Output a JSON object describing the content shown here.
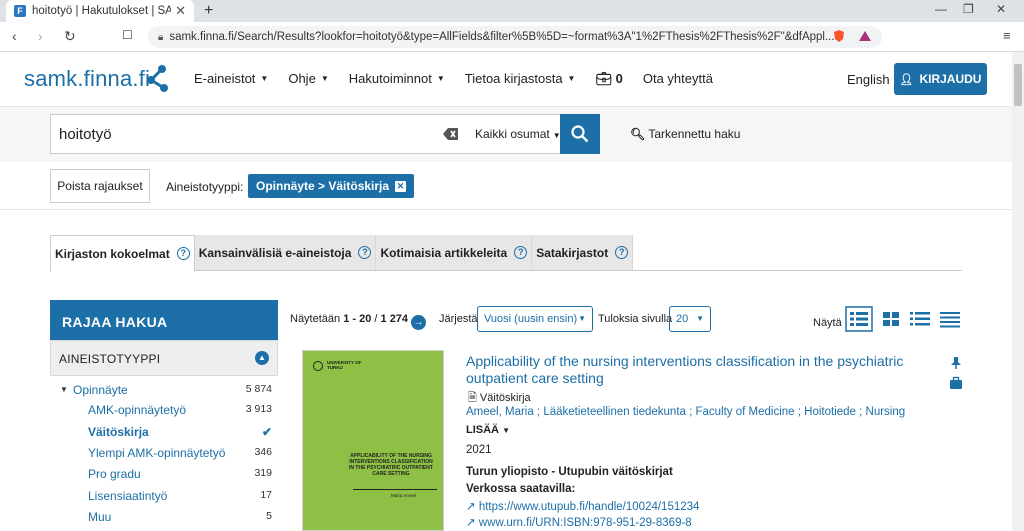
{
  "browser": {
    "tab_title": "hoitotyö | Hakutulokset | SAMK F",
    "favicon_letter": "F",
    "url": "samk.finna.fi/Search/Results?lookfor=hoitotyö&type=AllFields&filter%5B%5D=~format%3A\"1%2FThesis%2FThesis%2F\"&dfAppl..."
  },
  "header": {
    "logo": "samk.finna.fi",
    "nav": [
      "E-aineistot",
      "Ohje",
      "Hakutoiminnot",
      "Tietoa kirjastosta"
    ],
    "bag_count": "0",
    "contact": "Ota yhteyttä",
    "language": "English",
    "login": "KIRJAUDU"
  },
  "search": {
    "term": "hoitotyö",
    "scope": "Kaikki osumat",
    "advanced": "Tarkennettu haku"
  },
  "filters": {
    "remove_all": "Poista rajaukset",
    "label": "Aineistotyyppi:",
    "active": "Opinnäyte > Väitöskirja"
  },
  "tabs": [
    "Kirjaston kokoelmat",
    "Kansainvälisiä e-aineistoja",
    "Kotimaisia artikkeleita",
    "Satakirjastot"
  ],
  "sidebar": {
    "title": "RAJAA HAKUA",
    "facet_title": "AINEISTOTYYPPI",
    "items": [
      {
        "label": "Opinnäyte",
        "count": "5 874"
      },
      {
        "label": "AMK-opinnäytetyö",
        "count": "3 913"
      },
      {
        "label": "Väitöskirja",
        "count": ""
      },
      {
        "label": "Ylempi AMK-opinnäytetyö",
        "count": "346"
      },
      {
        "label": "Pro gradu",
        "count": "319"
      },
      {
        "label": "Lisensiaatintyö",
        "count": "17"
      },
      {
        "label": "Muu",
        "count": "5"
      }
    ]
  },
  "results_header": {
    "showing_prefix": "Näytetään ",
    "range": "1 - 20",
    "separator": " / ",
    "total": "1 274",
    "sort_label": "Järjestä",
    "sort_value": "Vuosi (uusin ensin)",
    "per_page_label": "Tuloksia sivulla",
    "per_page_value": "20",
    "view_label": "Näytä"
  },
  "result": {
    "cover_university": "UNIVERSITY OF TURKU",
    "cover_title": "APPLICABILITY OF THE NURSING INTERVENTIONS CLASSIFICATION IN THE PSYCHIATRIC OUTPATIENT CARE SETTING",
    "cover_author": "Maria Ameel",
    "title": "Applicability of the nursing interventions classification in the psychiatric outpatient care setting",
    "format": "Väitöskirja",
    "authors": "Ameel, Maria ; Lääketieteellinen tiedekunta ; Faculty of Medicine ; Hoitotiede ; Nursing",
    "more": "LISÄÄ",
    "year": "2021",
    "series": "Turun yliopisto - Utupubin väitöskirjat",
    "online_label": "Verkossa saatavilla:",
    "links": [
      "https://www.utupub.fi/handle/10024/151234",
      "www.urn.fi/URN:ISBN:978-951-29-8369-8"
    ]
  },
  "colors": {
    "brand": "#1c6fa7",
    "cover": "#8dc044"
  }
}
